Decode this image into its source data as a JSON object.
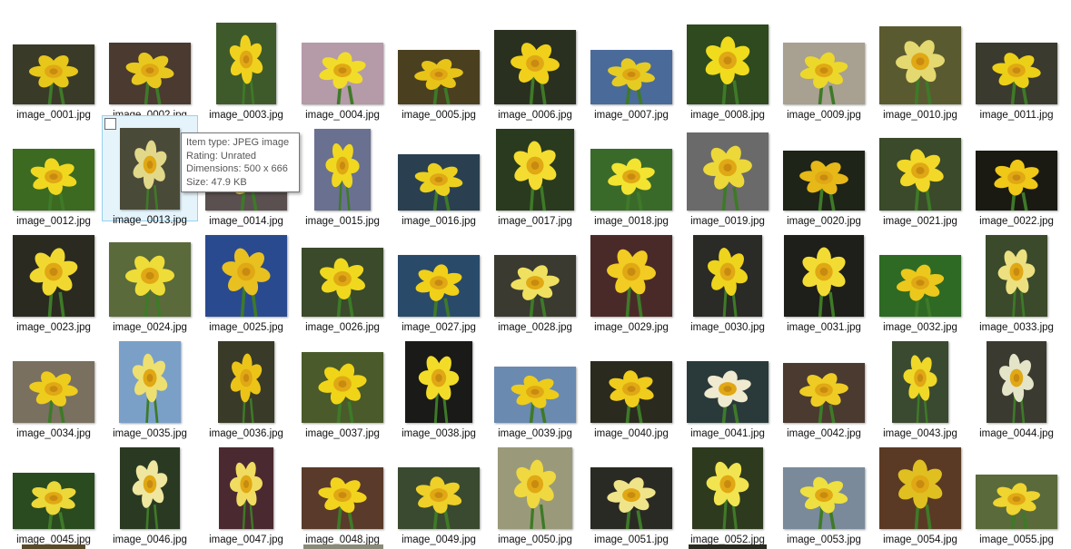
{
  "files": [
    {
      "name": "image_0001.jpg",
      "w": 90,
      "h": 66,
      "bg": "#3a3a28",
      "flower": "#e6c71a"
    },
    {
      "name": "image_0002.jpg",
      "w": 90,
      "h": 68,
      "bg": "#4a3a30",
      "flower": "#e8c81e"
    },
    {
      "name": "image_0003.jpg",
      "w": 66,
      "h": 90,
      "bg": "#3f5a2a",
      "flower": "#f0d21e"
    },
    {
      "name": "image_0004.jpg",
      "w": 90,
      "h": 68,
      "bg": "#b59aa8",
      "flower": "#f2dc2a"
    },
    {
      "name": "image_0005.jpg",
      "w": 90,
      "h": 60,
      "bg": "#4a4020",
      "flower": "#e8c418"
    },
    {
      "name": "image_0006.jpg",
      "w": 90,
      "h": 82,
      "bg": "#2a3020",
      "flower": "#f0d01a"
    },
    {
      "name": "image_0007.jpg",
      "w": 90,
      "h": 60,
      "bg": "#4a6a9a",
      "flower": "#e6cc22"
    },
    {
      "name": "image_0008.jpg",
      "w": 90,
      "h": 88,
      "bg": "#2e4a1e",
      "flower": "#f0dc1c"
    },
    {
      "name": "image_0009.jpg",
      "w": 90,
      "h": 68,
      "bg": "#a8a090",
      "flower": "#ecd82a"
    },
    {
      "name": "image_0010.jpg",
      "w": 90,
      "h": 86,
      "bg": "#5a5a30",
      "flower": "#e4d870"
    },
    {
      "name": "image_0011.jpg",
      "w": 90,
      "h": 68,
      "bg": "#3a3a2e",
      "flower": "#ecd018"
    },
    {
      "name": "image_0012.jpg",
      "w": 90,
      "h": 68,
      "bg": "#3c6a20",
      "flower": "#f0d820"
    },
    {
      "name": "image_0013.jpg",
      "w": 66,
      "h": 90,
      "bg": "#4a4a38",
      "flower": "#e2d88a"
    },
    {
      "name": "image_0014.jpg",
      "w": 90,
      "h": 68,
      "bg": "#5a5050",
      "flower": "#e8d040"
    },
    {
      "name": "image_0015.jpg",
      "w": 62,
      "h": 90,
      "bg": "#6a7090",
      "flower": "#f0d820"
    },
    {
      "name": "image_0016.jpg",
      "w": 90,
      "h": 62,
      "bg": "#2a4050",
      "flower": "#ecd020"
    },
    {
      "name": "image_0017.jpg",
      "w": 86,
      "h": 90,
      "bg": "#2a3a1e",
      "flower": "#f4dc30"
    },
    {
      "name": "image_0018.jpg",
      "w": 90,
      "h": 68,
      "bg": "#3a6a2a",
      "flower": "#f2e430"
    },
    {
      "name": "image_0019.jpg",
      "w": 90,
      "h": 86,
      "bg": "#6a6a6a",
      "flower": "#ecd838"
    },
    {
      "name": "image_0020.jpg",
      "w": 90,
      "h": 66,
      "bg": "#1e2418",
      "flower": "#e6b818"
    },
    {
      "name": "image_0021.jpg",
      "w": 90,
      "h": 80,
      "bg": "#3a4a2a",
      "flower": "#f2d828"
    },
    {
      "name": "image_0022.jpg",
      "w": 90,
      "h": 66,
      "bg": "#1a1a12",
      "flower": "#f0c818"
    },
    {
      "name": "image_0023.jpg",
      "w": 90,
      "h": 90,
      "bg": "#2a2a20",
      "flower": "#f0d830"
    },
    {
      "name": "image_0024.jpg",
      "w": 90,
      "h": 82,
      "bg": "#5a6a3a",
      "flower": "#eedc38"
    },
    {
      "name": "image_0025.jpg",
      "w": 90,
      "h": 90,
      "bg": "#2a4a90",
      "flower": "#e8c020"
    },
    {
      "name": "image_0026.jpg",
      "w": 90,
      "h": 76,
      "bg": "#3a4a2a",
      "flower": "#f0d81e"
    },
    {
      "name": "image_0027.jpg",
      "w": 90,
      "h": 68,
      "bg": "#2a4a6a",
      "flower": "#f0d018"
    },
    {
      "name": "image_0028.jpg",
      "w": 90,
      "h": 68,
      "bg": "#3a3a30",
      "flower": "#f0e060"
    },
    {
      "name": "image_0029.jpg",
      "w": 90,
      "h": 90,
      "bg": "#4a2a28",
      "flower": "#f2cc22"
    },
    {
      "name": "image_0030.jpg",
      "w": 76,
      "h": 90,
      "bg": "#2a2a26",
      "flower": "#eed41c"
    },
    {
      "name": "image_0031.jpg",
      "w": 88,
      "h": 90,
      "bg": "#1e1e1a",
      "flower": "#f2dc34"
    },
    {
      "name": "image_0032.jpg",
      "w": 90,
      "h": 68,
      "bg": "#2e6a24",
      "flower": "#ecc81c"
    },
    {
      "name": "image_0033.jpg",
      "w": 68,
      "h": 90,
      "bg": "#3a4a2a",
      "flower": "#ece080"
    },
    {
      "name": "image_0034.jpg",
      "w": 90,
      "h": 68,
      "bg": "#7a7060",
      "flower": "#eecc1e"
    },
    {
      "name": "image_0035.jpg",
      "w": 68,
      "h": 90,
      "bg": "#7aa0c8",
      "flower": "#eee070"
    },
    {
      "name": "image_0036.jpg",
      "w": 62,
      "h": 90,
      "bg": "#3a3a28",
      "flower": "#ecc418"
    },
    {
      "name": "image_0037.jpg",
      "w": 90,
      "h": 78,
      "bg": "#4a5a2a",
      "flower": "#f0d418"
    },
    {
      "name": "image_0038.jpg",
      "w": 74,
      "h": 90,
      "bg": "#1a1a18",
      "flower": "#f2dc28"
    },
    {
      "name": "image_0039.jpg",
      "w": 90,
      "h": 62,
      "bg": "#6a8ab0",
      "flower": "#eecc1a"
    },
    {
      "name": "image_0040.jpg",
      "w": 90,
      "h": 68,
      "bg": "#2a2a1e",
      "flower": "#f0cc1c"
    },
    {
      "name": "image_0041.jpg",
      "w": 90,
      "h": 68,
      "bg": "#2a3a3a",
      "flower": "#f0ead0"
    },
    {
      "name": "image_0042.jpg",
      "w": 90,
      "h": 66,
      "bg": "#4a3a30",
      "flower": "#eecc24"
    },
    {
      "name": "image_0043.jpg",
      "w": 62,
      "h": 90,
      "bg": "#3a4a30",
      "flower": "#f0d828"
    },
    {
      "name": "image_0044.jpg",
      "w": 66,
      "h": 90,
      "bg": "#3a3a30",
      "flower": "#e4e4c8"
    },
    {
      "name": "image_0045.jpg",
      "w": 90,
      "h": 62,
      "bg": "#2a4a20",
      "flower": "#ecd838"
    },
    {
      "name": "image_0046.jpg",
      "w": 66,
      "h": 90,
      "bg": "#2a3a22",
      "flower": "#efe6a0"
    },
    {
      "name": "image_0047.jpg",
      "w": 60,
      "h": 90,
      "bg": "#4a2a30",
      "flower": "#f0dc60"
    },
    {
      "name": "image_0048.jpg",
      "w": 90,
      "h": 68,
      "bg": "#5a3a2a",
      "flower": "#f2d41e"
    },
    {
      "name": "image_0049.jpg",
      "w": 90,
      "h": 68,
      "bg": "#3a4a30",
      "flower": "#eed028"
    },
    {
      "name": "image_0050.jpg",
      "w": 82,
      "h": 90,
      "bg": "#9a9a7a",
      "flower": "#f0d840"
    },
    {
      "name": "image_0051.jpg",
      "w": 90,
      "h": 68,
      "bg": "#2a2a24",
      "flower": "#f0e48a"
    },
    {
      "name": "image_0052.jpg",
      "w": 78,
      "h": 90,
      "bg": "#2e3a1e",
      "flower": "#f2e450"
    },
    {
      "name": "image_0053.jpg",
      "w": 90,
      "h": 68,
      "bg": "#7a8a9a",
      "flower": "#eee040"
    },
    {
      "name": "image_0054.jpg",
      "w": 90,
      "h": 90,
      "bg": "#5a3a24",
      "flower": "#e0c020"
    },
    {
      "name": "image_0055.jpg",
      "w": 90,
      "h": 60,
      "bg": "#5a6a3a",
      "flower": "#f0d430"
    }
  ],
  "selected_index": 12,
  "tooltip": {
    "type": "Item type: JPEG image",
    "rating": "Rating: Unrated",
    "dimensions": "Dimensions: 500 x 666",
    "size": "Size: 47.9 KB"
  }
}
